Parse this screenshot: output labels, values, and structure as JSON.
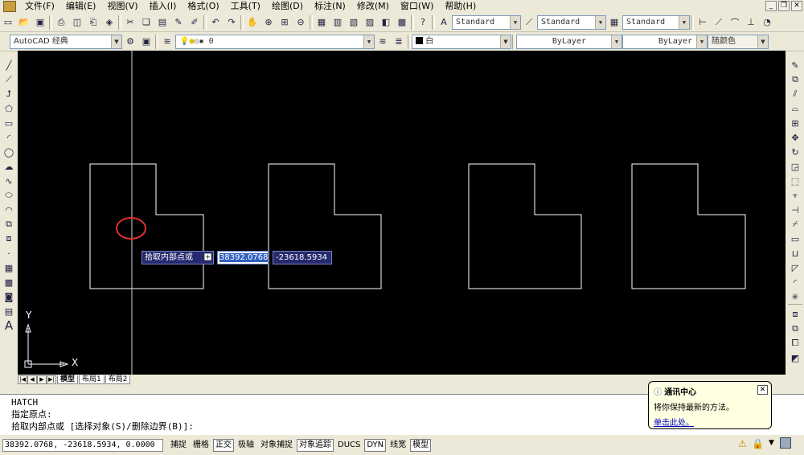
{
  "menu": [
    "文件(F)",
    "编辑(E)",
    "视图(V)",
    "插入(I)",
    "格式(O)",
    "工具(T)",
    "绘图(D)",
    "标注(N)",
    "修改(M)",
    "窗口(W)",
    "帮助(H)"
  ],
  "styles": {
    "text_style": "Standard",
    "dim_style": "Standard",
    "table_style": "Standard"
  },
  "workspace": "AutoCAD 经典",
  "layer": "0",
  "color": "白",
  "linetype": "ByLayer",
  "lineweight": "ByLayer",
  "plotstyle": "随颜色",
  "dynamic_input": {
    "prompt": "拾取内部点或",
    "x_value": "38392.0768",
    "y_value": "-23618.5934"
  },
  "ucs": {
    "y": "Y",
    "x": "X"
  },
  "tabs": [
    "模型",
    "布局1",
    "布局2"
  ],
  "command_lines": [
    "HATCH",
    "指定原点:",
    "拾取内部点或 [选择对象(S)/删除边界(B)]:"
  ],
  "status": {
    "coords": "38392.0768,  -23618.5934, 0.0000",
    "buttons": [
      {
        "label": "捕捉",
        "on": false
      },
      {
        "label": "栅格",
        "on": false
      },
      {
        "label": "正交",
        "on": true
      },
      {
        "label": "极轴",
        "on": false
      },
      {
        "label": "对象捕捉",
        "on": false
      },
      {
        "label": "对象追踪",
        "on": true
      },
      {
        "label": "DUCS",
        "on": false
      },
      {
        "label": "DYN",
        "on": true
      },
      {
        "label": "线宽",
        "on": false
      },
      {
        "label": "模型",
        "on": true
      }
    ]
  },
  "balloon": {
    "title": "通讯中心",
    "body": "将你保持最新的方法。",
    "link": "单击此处。"
  },
  "colors": {
    "canvas": "#000000",
    "highlight_circle": "#e03030",
    "ui_bg": "#ece9d8"
  }
}
